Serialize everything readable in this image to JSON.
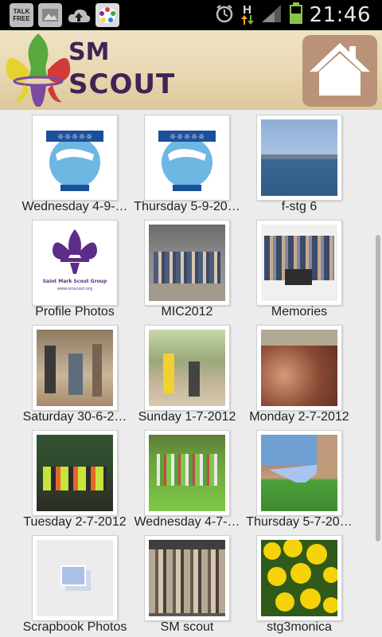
{
  "status_bar": {
    "time": "21:46",
    "network": "H",
    "icons": [
      "talk-free-icon",
      "gallery-icon",
      "cloud-upload-icon",
      "app-icon",
      "alarm-icon",
      "network-h-icon",
      "signal-icon",
      "battery-icon"
    ],
    "talk_label": "TALK FREE"
  },
  "header": {
    "title_line1": "SM",
    "title_line2": "SCOUT"
  },
  "albums": [
    {
      "label": "Wednesday 4-9-…",
      "kind": "logo-blue"
    },
    {
      "label": "Thursday 5-9-20…",
      "kind": "logo-blue"
    },
    {
      "label": "f-stg 6",
      "kind": "sea"
    },
    {
      "label": "Profile Photos",
      "kind": "fleur",
      "thumb_text": "Saint Mark Scout Group",
      "thumb_url": "www.smscout.org"
    },
    {
      "label": "MIC2012",
      "kind": "group"
    },
    {
      "label": "Memories",
      "kind": "group2"
    },
    {
      "label": "Saturday 30-6-2…",
      "kind": "camp1"
    },
    {
      "label": "Sunday 1-7-2012",
      "kind": "camp2"
    },
    {
      "label": "Monday 2-7-2012",
      "kind": "crowd"
    },
    {
      "label": "Tuesday 2-7-2012",
      "kind": "vests"
    },
    {
      "label": "Wednesday 4-7-…",
      "kind": "lawn"
    },
    {
      "label": "Thursday 5-7-20…",
      "kind": "tent"
    },
    {
      "label": "Scrapbook Photos",
      "kind": "placeholder"
    },
    {
      "label": "SM scout",
      "kind": "uniforms"
    },
    {
      "label": "stg3monica",
      "kind": "flowers"
    }
  ]
}
